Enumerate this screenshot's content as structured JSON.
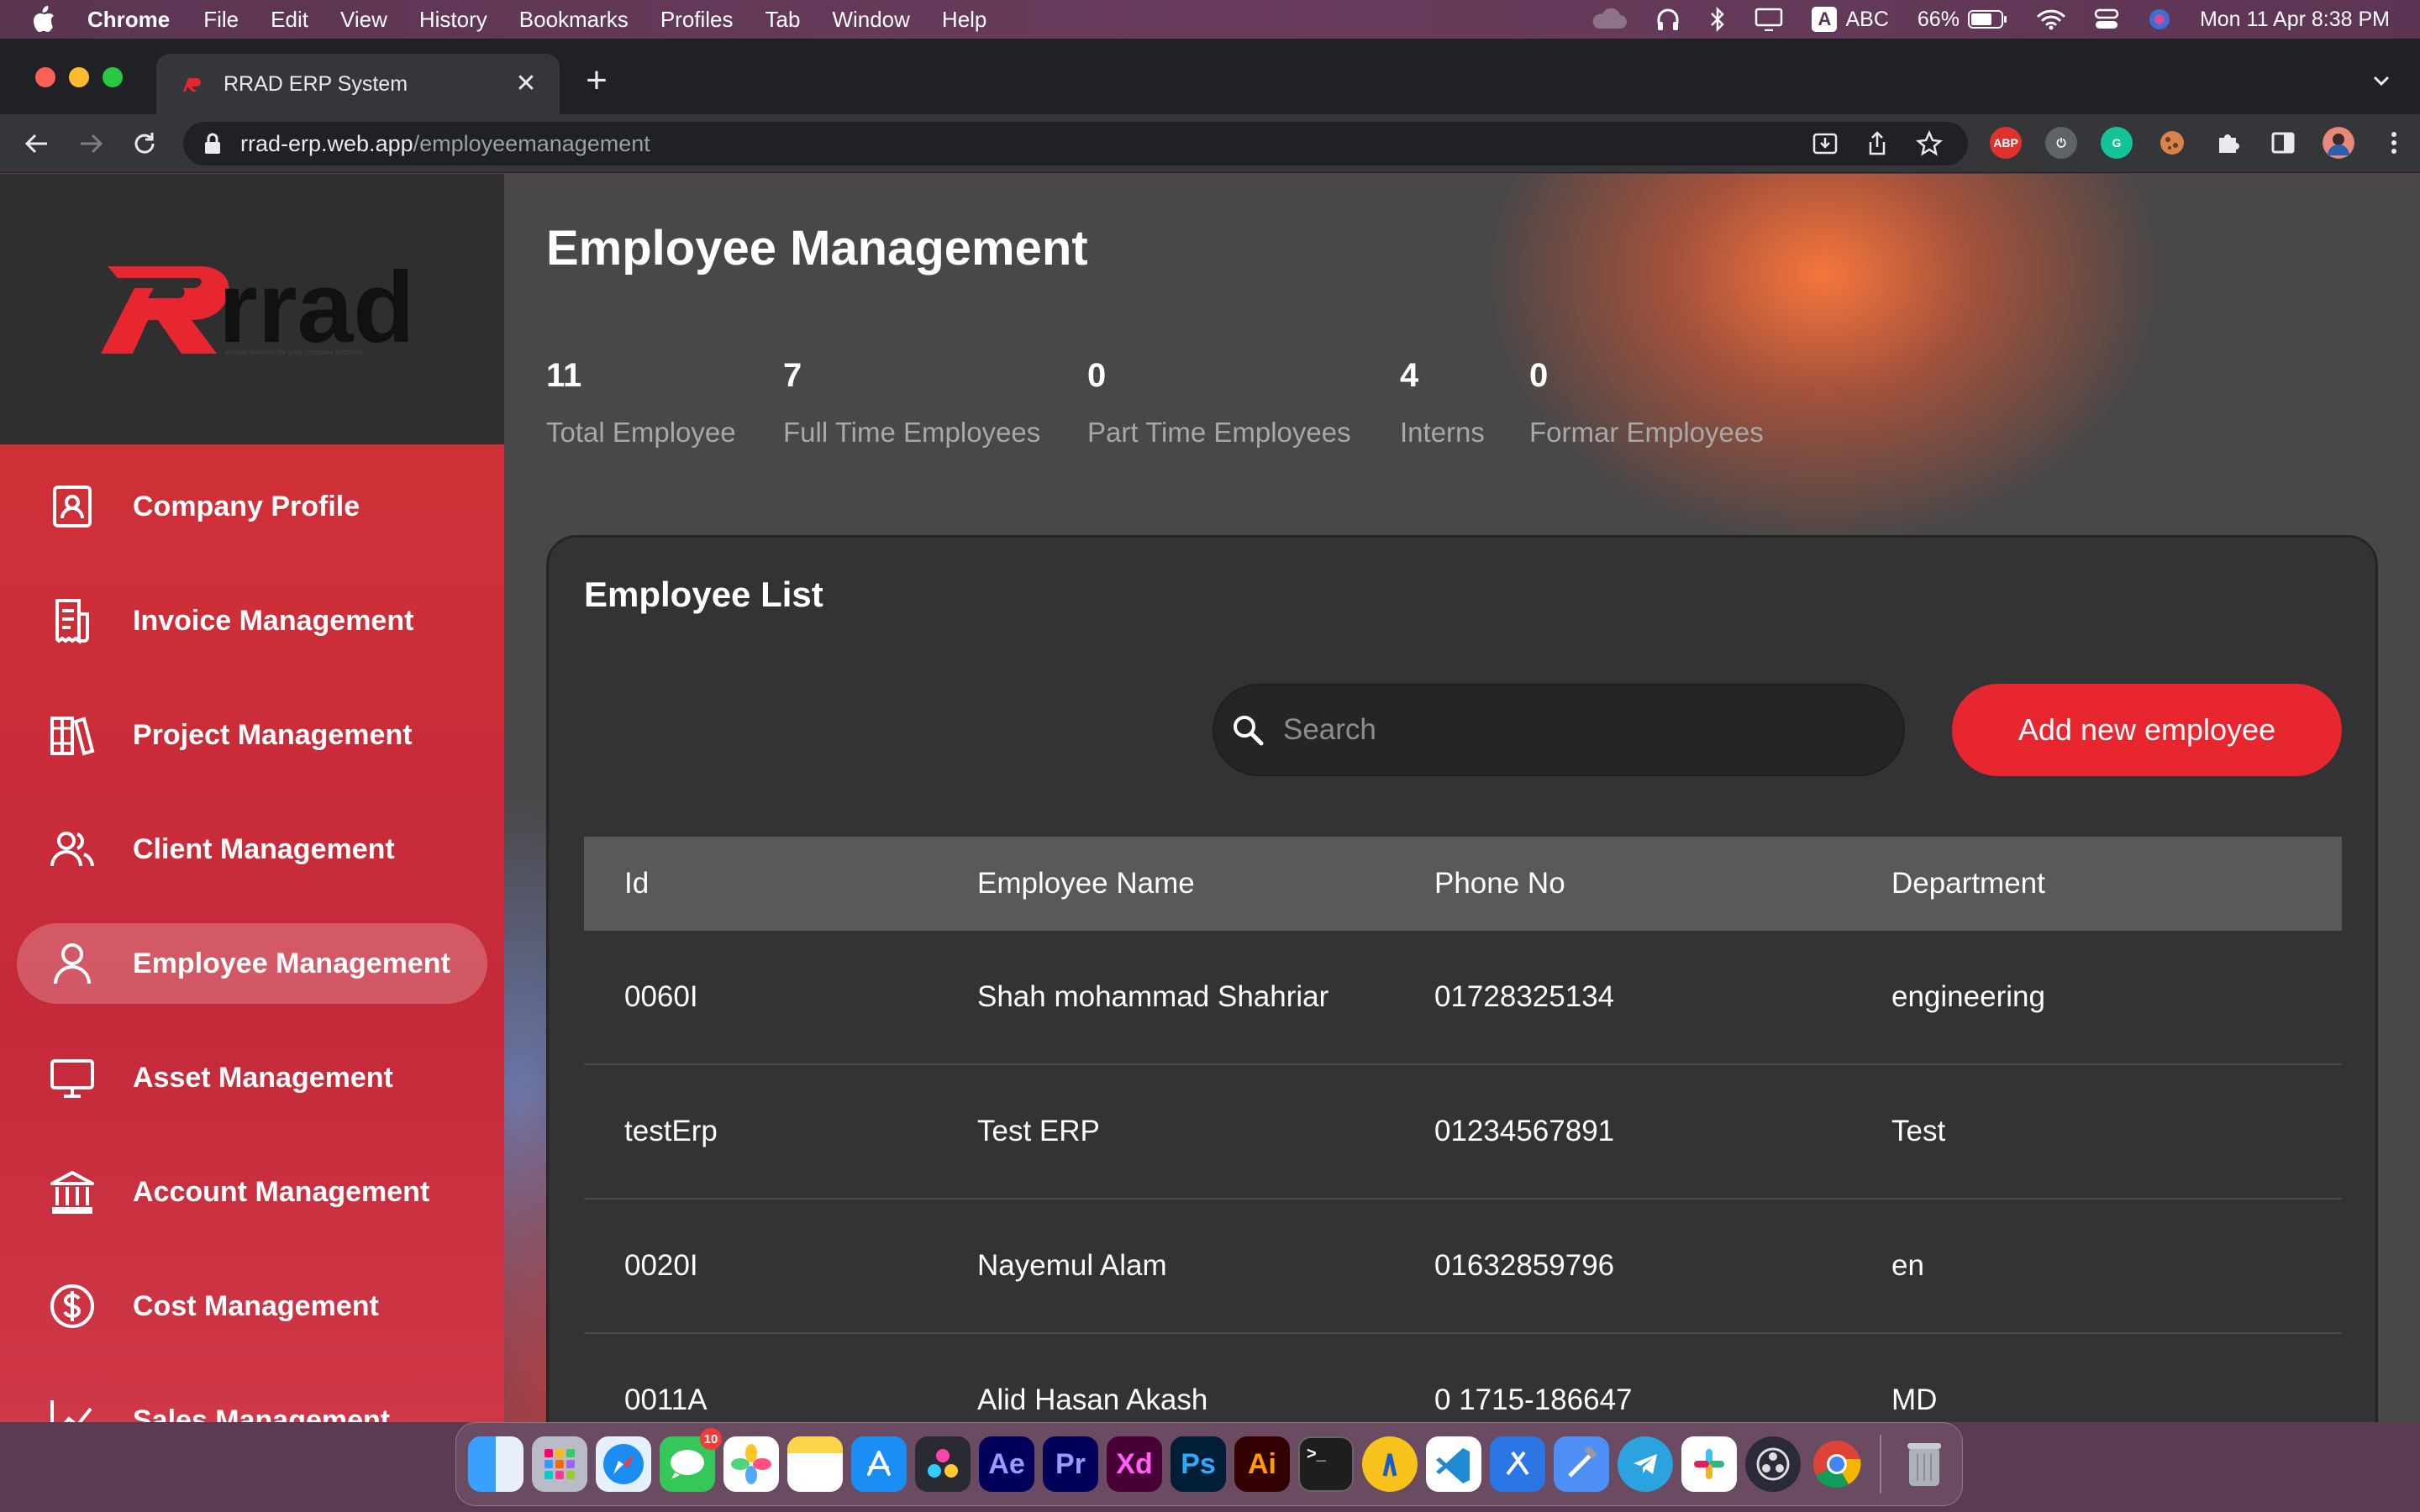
{
  "menubar": {
    "app_name": "Chrome",
    "items": [
      "File",
      "Edit",
      "View",
      "History",
      "Bookmarks",
      "Profiles",
      "Tab",
      "Window",
      "Help"
    ],
    "input_source": "ABC",
    "input_key": "A",
    "battery": "66%",
    "datetime": "Mon 11 Apr  8:38 PM"
  },
  "browser": {
    "tab_title": "RRAD ERP System",
    "url_host": "rrad-erp.web.app",
    "url_path": "/employeemanagement",
    "extensions": [
      "ABP",
      "power-icon",
      "grammarly-icon",
      "cookie-icon",
      "puzzle-icon",
      "sidepanel-icon",
      "profile-avatar",
      "kebab-icon"
    ]
  },
  "brand": {
    "logo_text": "rrad",
    "tagline": "simple solution for your complex problem",
    "accent": "#e8262f",
    "sidebar_red": "#c52a3a"
  },
  "sidebar": {
    "items": [
      {
        "label": "Company Profile",
        "icon": "id-card-icon"
      },
      {
        "label": "Invoice Management",
        "icon": "invoice-icon"
      },
      {
        "label": "Project Management",
        "icon": "books-icon"
      },
      {
        "label": "Client Management",
        "icon": "users-icon"
      },
      {
        "label": "Employee Management",
        "icon": "user-icon",
        "active": true
      },
      {
        "label": "Asset Management",
        "icon": "monitor-icon"
      },
      {
        "label": "Account Management",
        "icon": "bank-icon"
      },
      {
        "label": "Cost Management",
        "icon": "dollar-icon"
      },
      {
        "label": "Sales Management",
        "icon": "chart-icon"
      }
    ]
  },
  "page": {
    "title": "Employee Management",
    "stats": [
      {
        "value": "11",
        "label": "Total Employee"
      },
      {
        "value": "7",
        "label": "Full Time Employees"
      },
      {
        "value": "0",
        "label": "Part Time Employees"
      },
      {
        "value": "4",
        "label": "Interns"
      },
      {
        "value": "0",
        "label": "Formar Employees"
      }
    ]
  },
  "employee_list": {
    "title": "Employee List",
    "search_placeholder": "Search",
    "add_button": "Add new employee",
    "columns": [
      "Id",
      "Employee Name",
      "Phone No",
      "Department"
    ],
    "rows": [
      [
        "0060I",
        "Shah mohammad Shahriar",
        "01728325134",
        "engineering"
      ],
      [
        "testErp",
        "Test ERP",
        "01234567891",
        "Test"
      ],
      [
        "0020I",
        "Nayemul Alam",
        "01632859796",
        "en"
      ],
      [
        "0011A",
        "Alid Hasan Akash",
        "0 1715-186647",
        "MD"
      ]
    ]
  },
  "dock": {
    "messages_badge": "10",
    "apps": [
      "Finder",
      "Launchpad",
      "Safari",
      "Messages",
      "Photos",
      "Notes",
      "App Store",
      "DaVinci Resolve",
      "Ae",
      "Pr",
      "Xd",
      "Ps",
      "Ai",
      "Terminal",
      "Xcode Instruments",
      "VS Code",
      "Xcode",
      "Xcode Build",
      "Telegram",
      "Slack",
      "OBS",
      "Chrome",
      "Trash"
    ]
  }
}
